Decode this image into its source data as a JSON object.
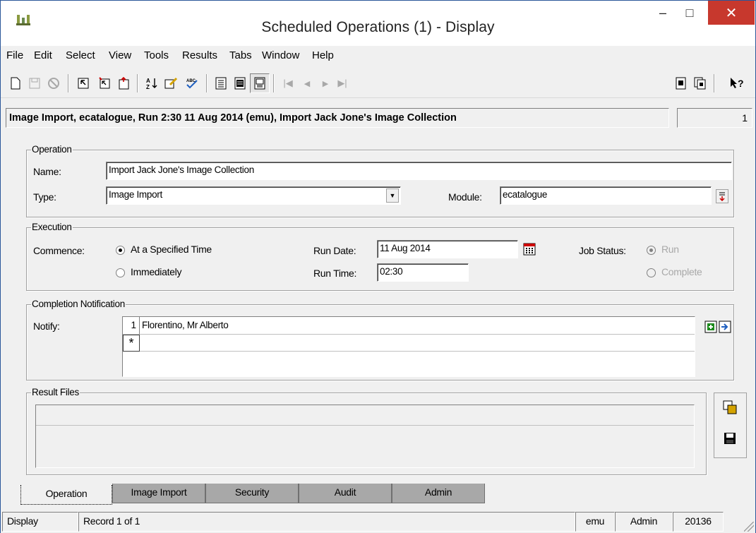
{
  "window": {
    "title": "Scheduled Operations (1) - Display",
    "minimize": "–",
    "maximize": "□",
    "close": "✕"
  },
  "menu": [
    "File",
    "Edit",
    "Select",
    "View",
    "Tools",
    "Results",
    "Tabs",
    "Window",
    "Help"
  ],
  "record": {
    "summary": "Image Import, ecatalogue, Run 2:30 11 Aug 2014 (emu), Import Jack Jone's Image Collection",
    "count": "1"
  },
  "operation": {
    "legend": "Operation",
    "name_label": "Name:",
    "name_value": "Import Jack Jone's Image Collection",
    "type_label": "Type:",
    "type_value": "Image Import",
    "module_label": "Module:",
    "module_value": "ecatalogue"
  },
  "execution": {
    "legend": "Execution",
    "commence_label": "Commence:",
    "opt_specified": "At a Specified Time",
    "opt_immediately": "Immediately",
    "commence_selected": "At a Specified Time",
    "run_date_label": "Run Date:",
    "run_date_value": "11 Aug 2014",
    "run_time_label": "Run Time:",
    "run_time_value": "02:30",
    "job_status_label": "Job Status:",
    "status_run": "Run",
    "status_complete": "Complete",
    "status_selected": "Run"
  },
  "completion": {
    "legend": "Completion Notification",
    "notify_label": "Notify:",
    "rows": [
      {
        "num": "1",
        "value": "Florentino, Mr Alberto"
      }
    ],
    "new_row_marker": "*"
  },
  "result_files": {
    "legend": "Result Files"
  },
  "tabs": [
    "Operation",
    "Image Import",
    "Security",
    "Audit",
    "Admin"
  ],
  "active_tab": "Operation",
  "status": {
    "mode": "Display",
    "record_pos": "Record 1 of 1",
    "db": "emu",
    "user": "Admin",
    "number": "20136"
  },
  "toolbar_icons": [
    "new-icon",
    "save-icon",
    "cancel-icon",
    "search-icon",
    "add-record-icon",
    "delete-record-icon",
    "sort-icon",
    "edit-icon",
    "spellcheck-icon",
    "list-view-icon",
    "details-view-icon",
    "page-view-icon",
    "first-record-icon",
    "prev-record-icon",
    "next-record-icon",
    "last-record-icon",
    "report-icon",
    "copy-icon",
    "help-icon"
  ],
  "colors": {
    "close_button": "#c7382d",
    "tab_inactive": "#a8a8a8",
    "accent_icon": "#d4a300"
  }
}
